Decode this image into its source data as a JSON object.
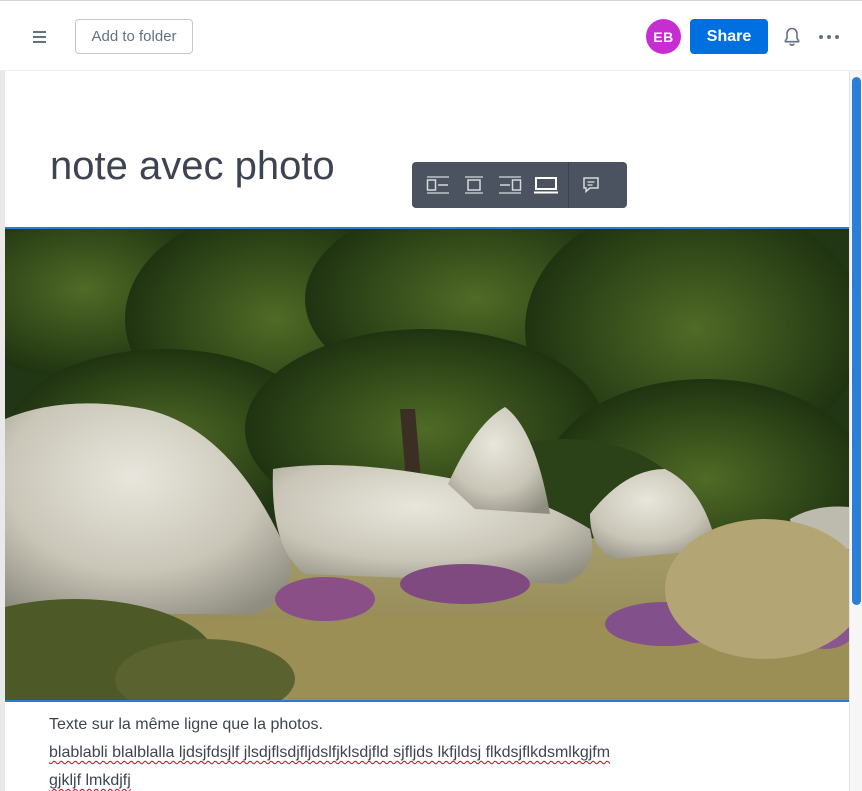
{
  "header": {
    "add_to_folder_label": "Add to folder",
    "avatar_initials": "EB",
    "share_label": "Share"
  },
  "document": {
    "title": "note avec photo",
    "paragraph_line1": "Texte sur la même ligne que la photos.",
    "paragraph_line2": "blablabli blalblalla ljdsjfdsjlf jlsdjflsdjfljdslfjklsdjfld sjfljds lkfjldsj flkdsjflkdsmlkgjfm",
    "paragraph_line3": "gjkljf lmkdjfj"
  },
  "image_toolbar": {
    "buttons": [
      "align-left-icon",
      "align-center-icon",
      "align-right-icon",
      "full-width-icon",
      "comment-icon"
    ],
    "active": "full-width-icon"
  },
  "colors": {
    "share": "#0070e0",
    "avatar": "#c62ed1",
    "selection": "#2a7ad8",
    "toolbar": "#4b5361"
  }
}
